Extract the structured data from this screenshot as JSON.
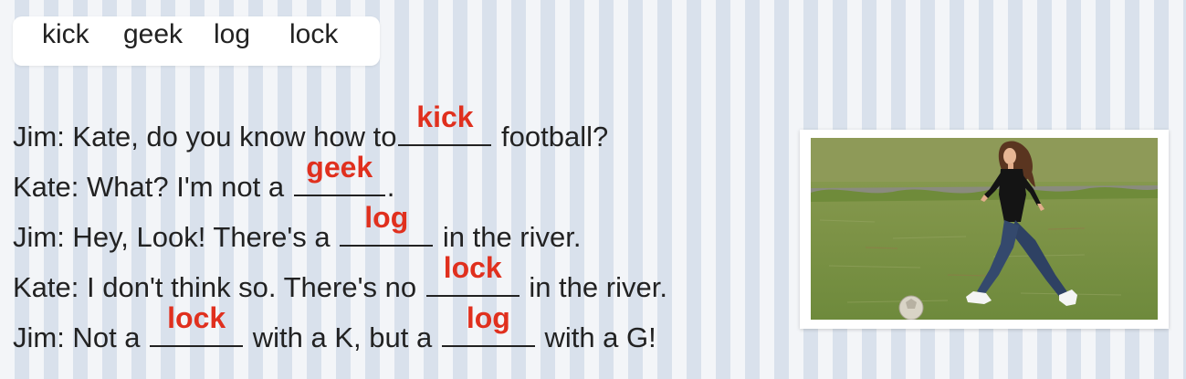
{
  "word_bank": {
    "words": [
      "kick",
      "geek",
      "log",
      "lock"
    ]
  },
  "dialogue": {
    "lines": [
      {
        "before": "Jim: Kate, do you know how to",
        "answer1": "kick",
        "after": " football?"
      },
      {
        "before": "Kate: What? I'm not a ",
        "answer1": "geek",
        "after": "."
      },
      {
        "before": "Jim: Hey, Look! There's a ",
        "answer1": "log",
        "after": " in the river."
      },
      {
        "before": "Kate: I don't think so. There's no ",
        "answer1": "lock",
        "after": " in the river."
      },
      {
        "before": "Jim: Not a ",
        "answer1": "lock",
        "middle": " with a K, but a ",
        "answer2": "log",
        "after": " with a G!"
      }
    ]
  },
  "colors": {
    "answer": "#e0301e",
    "stripe_light": "#f3f5f8",
    "stripe_dark": "#d9e1ec",
    "grass": "#7f9448"
  },
  "photo": {
    "subject": "girl kicking a soccer ball on grass"
  }
}
